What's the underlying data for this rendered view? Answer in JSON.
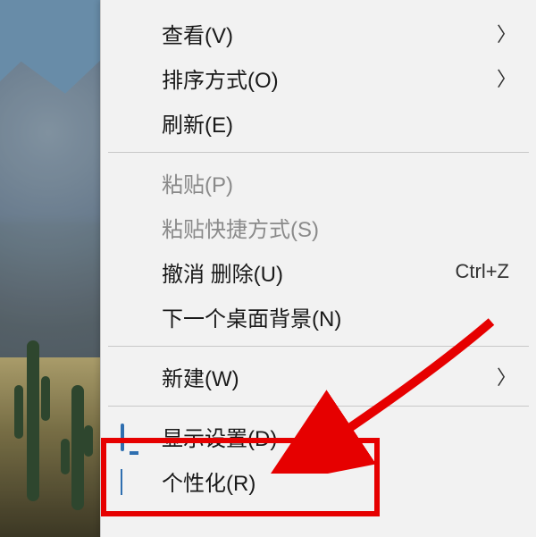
{
  "menu": {
    "view": {
      "label": "查看(V)",
      "hasSubmenu": true
    },
    "sort": {
      "label": "排序方式(O)",
      "hasSubmenu": true
    },
    "refresh": {
      "label": "刷新(E)"
    },
    "paste": {
      "label": "粘贴(P)",
      "disabled": true
    },
    "pasteShortcut": {
      "label": "粘贴快捷方式(S)",
      "disabled": true
    },
    "undo": {
      "label": "撤消 删除(U)",
      "shortcut": "Ctrl+Z"
    },
    "nextWallpaper": {
      "label": "下一个桌面背景(N)"
    },
    "new": {
      "label": "新建(W)",
      "hasSubmenu": true
    },
    "displaySettings": {
      "label": "显示设置(D)",
      "icon": "monitor"
    },
    "personalize": {
      "label": "个性化(R)",
      "icon": "personalize"
    }
  }
}
